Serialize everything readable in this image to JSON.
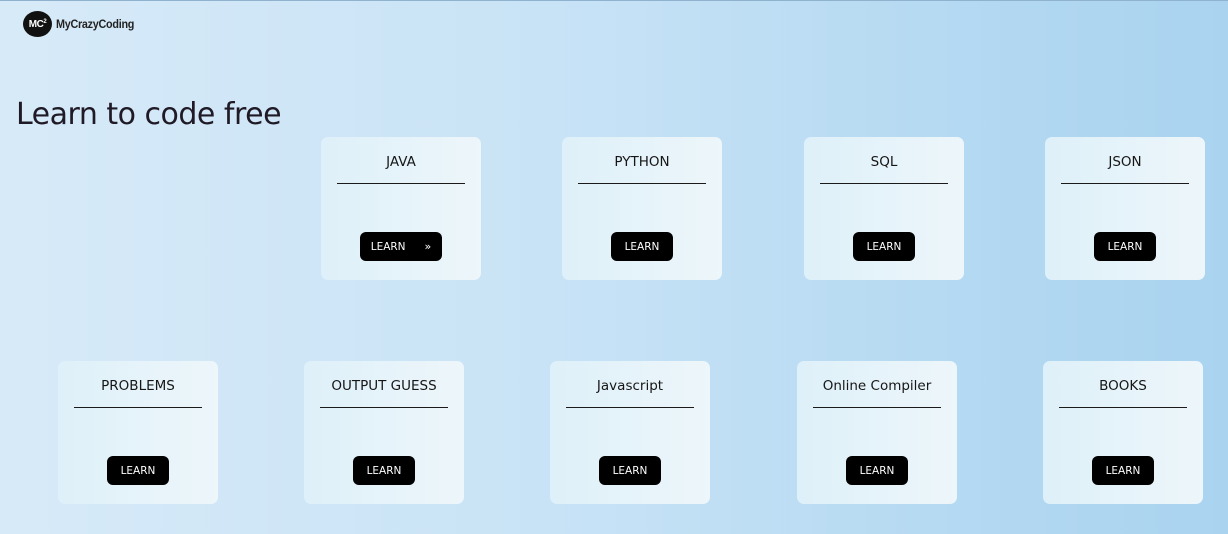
{
  "brand": {
    "logo_text": "MC",
    "logo_sup": "2",
    "name": "MyCrazyCoding"
  },
  "hero": {
    "title": "Learn to code free"
  },
  "cards": [
    {
      "title": "JAVA",
      "button": "LEARN",
      "arrow": "»"
    },
    {
      "title": "PYTHON",
      "button": "LEARN"
    },
    {
      "title": "SQL",
      "button": "LEARN"
    },
    {
      "title": "JSON",
      "button": "LEARN"
    },
    {
      "title": "PROBLEMS",
      "button": "LEARN"
    },
    {
      "title": "OUTPUT GUESS",
      "button": "LEARN"
    },
    {
      "title": "Javascript",
      "button": "LEARN"
    },
    {
      "title": "Online Compiler",
      "button": "LEARN"
    },
    {
      "title": "BOOKS",
      "button": "LEARN"
    }
  ]
}
